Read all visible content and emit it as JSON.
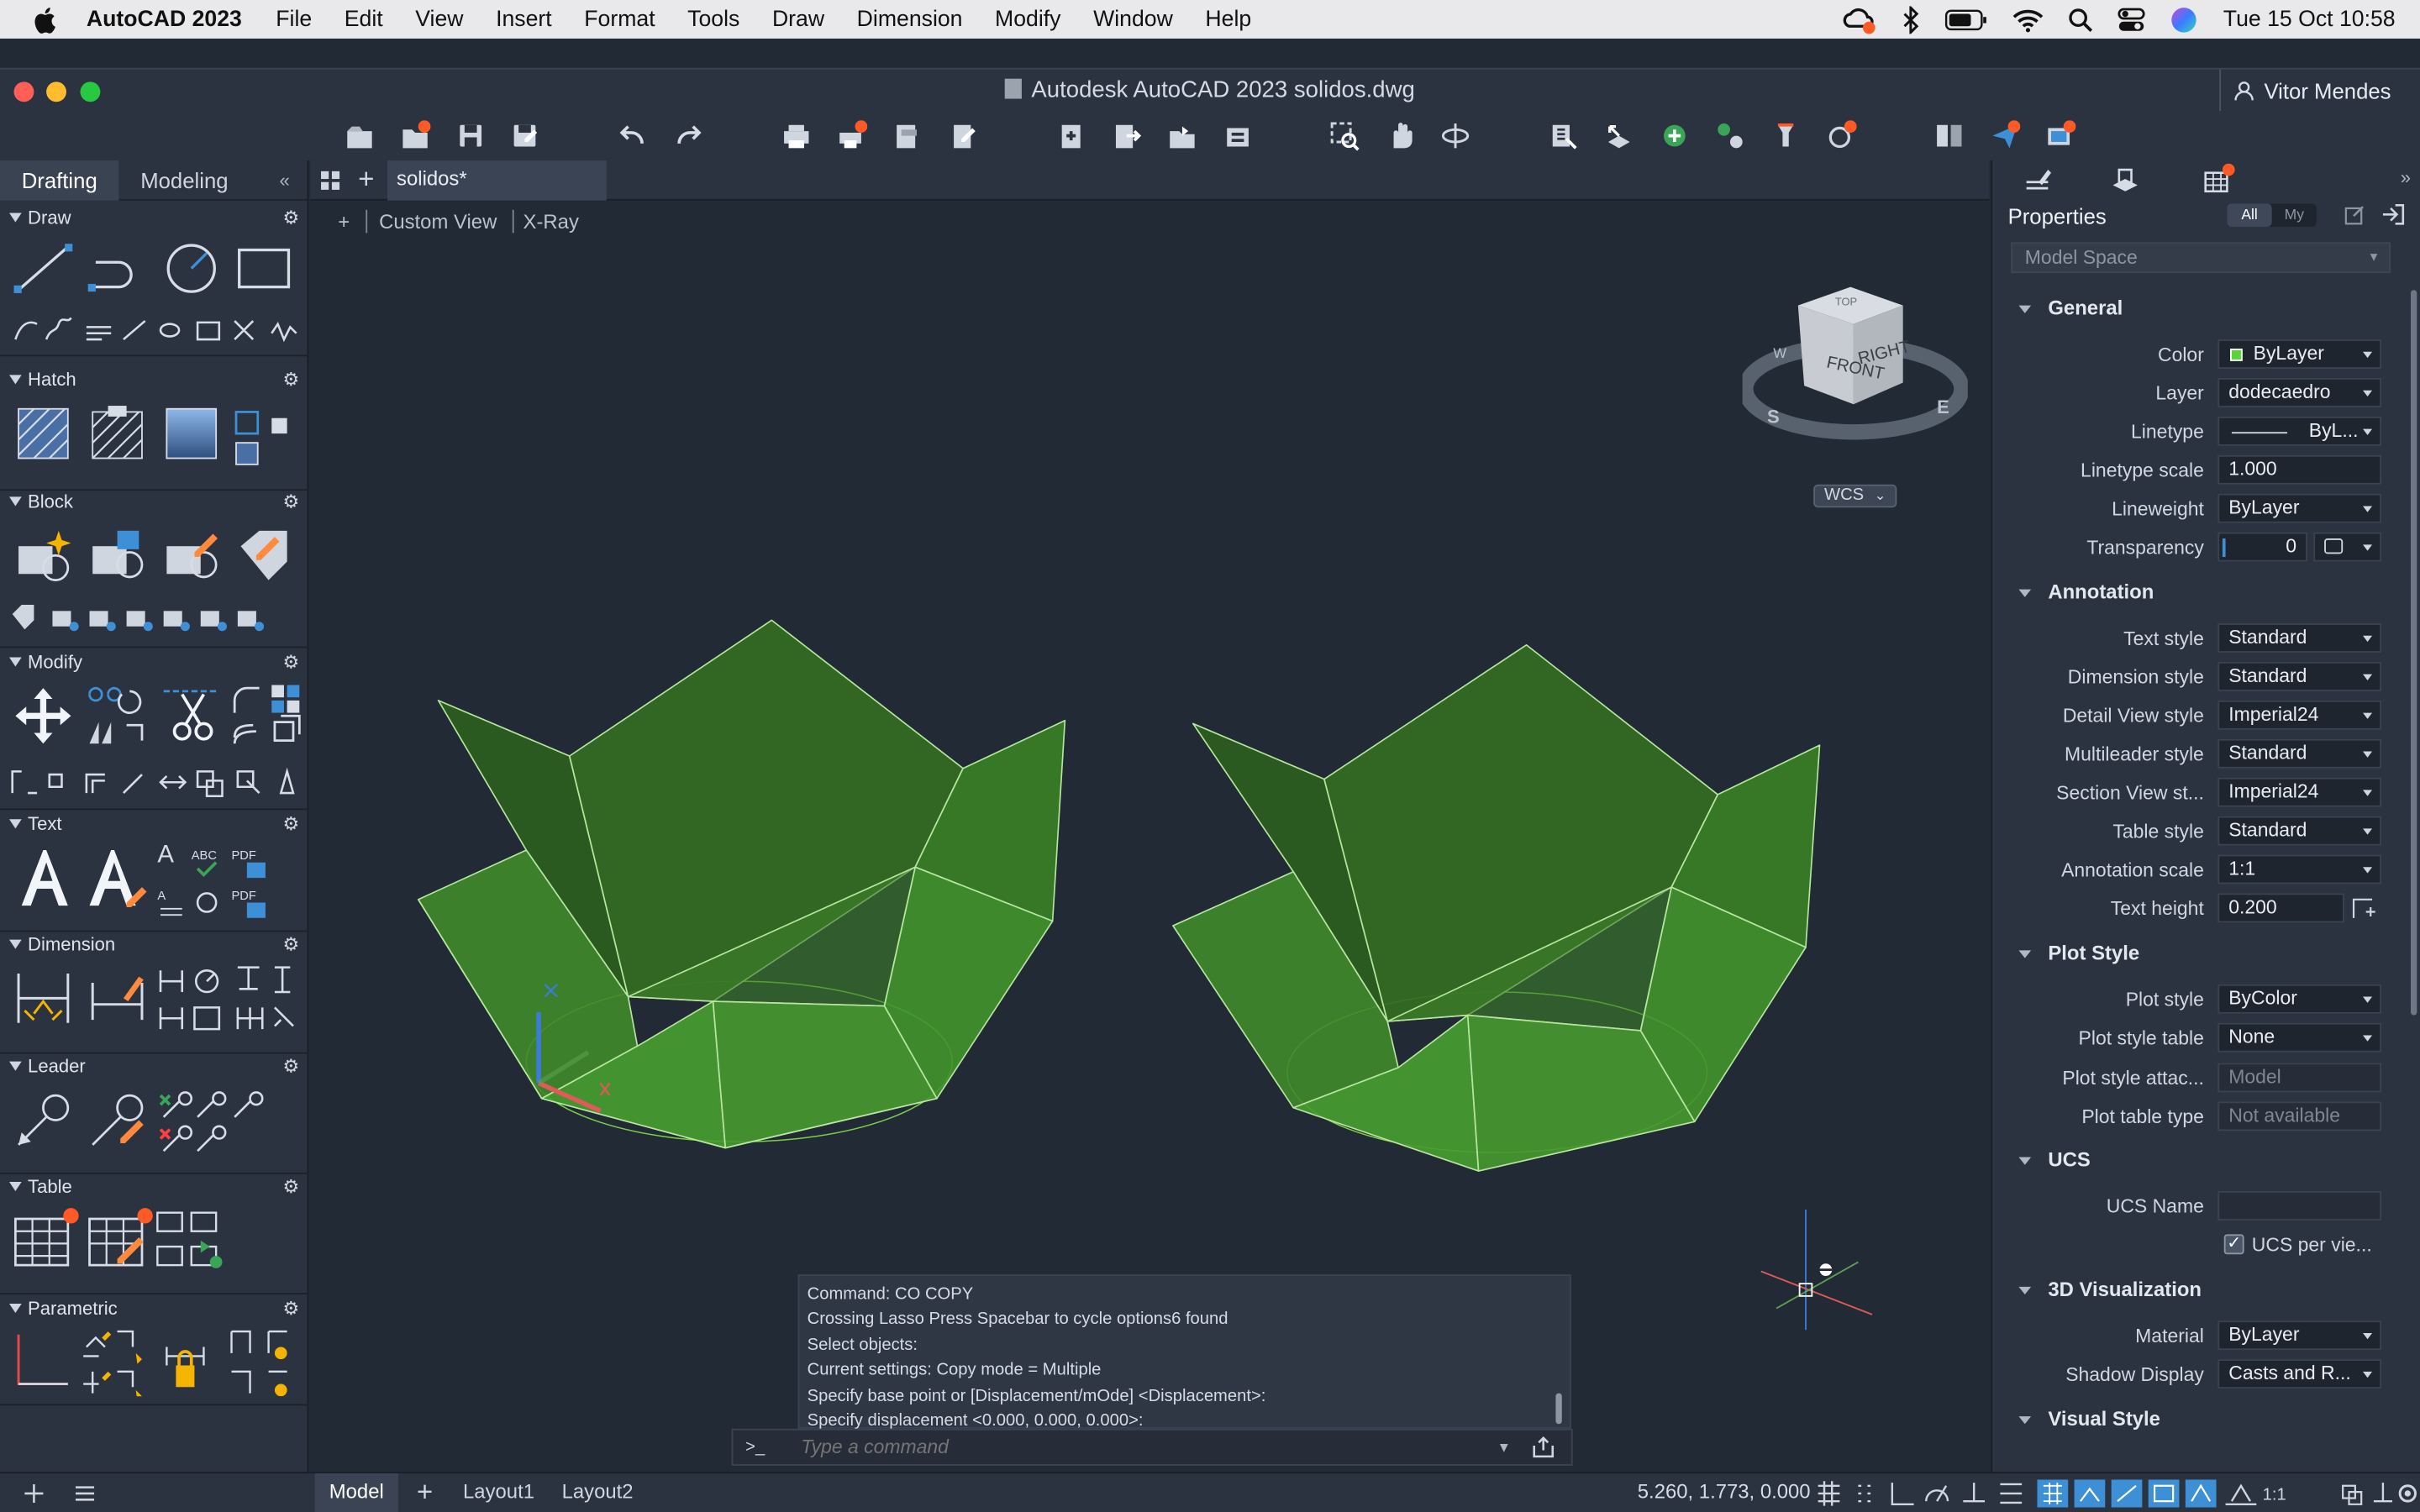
{
  "menubar": {
    "app": "AutoCAD 2023",
    "items": [
      "File",
      "Edit",
      "View",
      "Insert",
      "Format",
      "Tools",
      "Draw",
      "Dimension",
      "Modify",
      "Window",
      "Help"
    ],
    "clock": "Tue 15 Oct  10:58"
  },
  "window": {
    "title": "Autodesk AutoCAD 2023    solidos.dwg",
    "user": "Vitor Mendes"
  },
  "left_panel": {
    "tabs": [
      "Drafting",
      "Modeling"
    ],
    "sections": [
      "Draw",
      "Hatch",
      "Block",
      "Modify",
      "Text",
      "Dimension",
      "Leader",
      "Table",
      "Parametric"
    ]
  },
  "doc_tab": "solidos*",
  "viewport": {
    "view_label": "Custom View",
    "style_label": "X-Ray",
    "viewcube": {
      "front": "FRONT",
      "right": "RIGHT",
      "top": "TOP",
      "s": "S",
      "e": "E",
      "w": "W"
    },
    "wcs": "WCS"
  },
  "command": {
    "history": [
      "Command: CO COPY",
      "Crossing Lasso  Press Spacebar to cycle options6 found",
      "Select objects:",
      "Current settings:  Copy mode = Multiple",
      "Specify base point or [Displacement/mOde] <Displacement>:",
      "Specify displacement <0.000, 0.000, 0.000>:"
    ],
    "prompt": ">_",
    "placeholder": "Type a command"
  },
  "properties": {
    "title": "Properties",
    "filter_all": "All",
    "filter_my": "My",
    "space": "Model Space",
    "general": {
      "heading": "General",
      "color_label": "Color",
      "color": "ByLayer",
      "layer_label": "Layer",
      "layer": "dodecaedro",
      "linetype_label": "Linetype",
      "linetype": "ByL...",
      "linetype_scale_label": "Linetype scale",
      "linetype_scale": "1.000",
      "lineweight_label": "Lineweight",
      "lineweight": "ByLayer",
      "transparency_label": "Transparency",
      "transparency": "0"
    },
    "annotation": {
      "heading": "Annotation",
      "text_style_label": "Text style",
      "text_style": "Standard",
      "dimension_style_label": "Dimension style",
      "dimension_style": "Standard",
      "detail_view_style_label": "Detail View style",
      "detail_view_style": "Imperial24",
      "multileader_style_label": "Multileader style",
      "multileader_style": "Standard",
      "section_view_label": "Section View st...",
      "section_view": "Imperial24",
      "table_style_label": "Table style",
      "table_style": "Standard",
      "annotation_scale_label": "Annotation scale",
      "annotation_scale": "1:1",
      "text_height_label": "Text height",
      "text_height": "0.200"
    },
    "plot_style": {
      "heading": "Plot Style",
      "plot_style_label": "Plot style",
      "plot_style": "ByColor",
      "plot_style_table_label": "Plot style table",
      "plot_style_table": "None",
      "plot_style_attach_label": "Plot style attac...",
      "plot_style_attach": "Model",
      "plot_table_type_label": "Plot table type",
      "plot_table_type": "Not available"
    },
    "ucs": {
      "heading": "UCS",
      "ucs_name_label": "UCS Name",
      "ucs_name": "",
      "ucs_per_view": "UCS per vie..."
    },
    "vis3d": {
      "heading": "3D Visualization",
      "material_label": "Material",
      "material": "ByLayer",
      "shadow_label": "Shadow Display",
      "shadow": "Casts and R..."
    },
    "visual_style": {
      "heading": "Visual Style"
    }
  },
  "status": {
    "tabs": [
      "Model",
      "Layout1",
      "Layout2"
    ],
    "coords": "5.260, 1.773, 0.000",
    "scale": "1:1"
  },
  "colors": {
    "accent": "#ff5a25",
    "solid": "#3f8f2a",
    "panel": "#2b3340",
    "canvas": "#222a35"
  }
}
